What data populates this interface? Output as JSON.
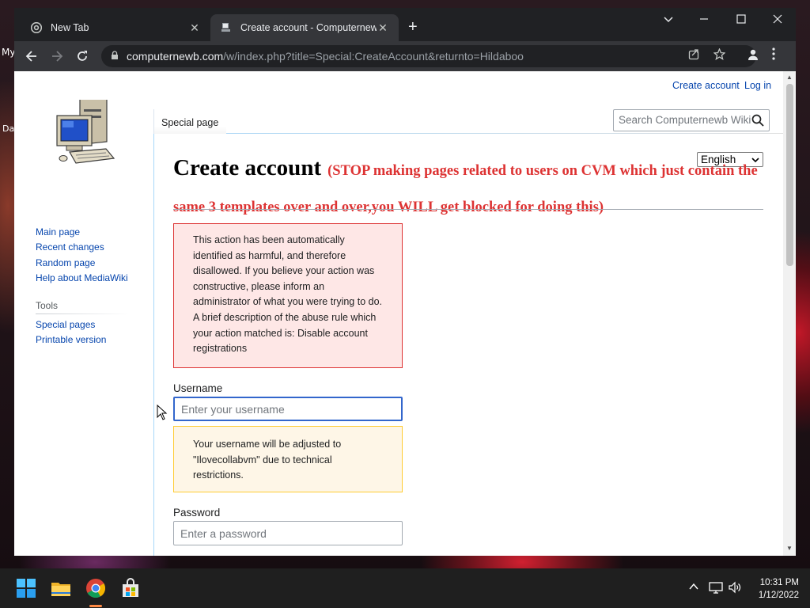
{
  "desktop": {
    "labels": [
      "My",
      "Da"
    ]
  },
  "browser": {
    "tabs": [
      {
        "title": "New Tab"
      },
      {
        "title": "Create account - Computernewb"
      }
    ],
    "new_tab_symbol": "+",
    "url_host": "computernewb.com",
    "url_path": "/w/index.php?title=Special:CreateAccount&returnto=Hildaboo"
  },
  "page": {
    "personal_links": {
      "create_account": "Create account",
      "log_in": "Log in"
    },
    "sidebar": {
      "nav": [
        "Main page",
        "Recent changes",
        "Random page",
        "Help about MediaWiki"
      ],
      "tools_heading": "Tools",
      "tools": [
        "Special pages",
        "Printable version"
      ]
    },
    "tab_special_page": "Special page",
    "search_placeholder": "Search Computernewb Wiki",
    "language": "English",
    "heading": {
      "title": "Create account",
      "notice": "(STOP making pages related to users on CVM which just contain the same 3 templates over and over,you WILL get blocked for doing this)"
    },
    "error_message": "This action has been automatically identified as harmful, and therefore disallowed. If you believe your action was constructive, please inform an administrator of what you were trying to do. A brief description of the abuse rule which your action matched is: Disable account registrations",
    "username": {
      "label": "Username",
      "placeholder": "Enter your username",
      "value": ""
    },
    "username_warning": "Your username will be adjusted to \"Ilovecollabvm\" due to technical restrictions.",
    "password": {
      "label": "Password",
      "placeholder": "Enter a password",
      "value": ""
    }
  },
  "taskbar": {
    "time": "10:31 PM",
    "date": "1/12/2022"
  }
}
